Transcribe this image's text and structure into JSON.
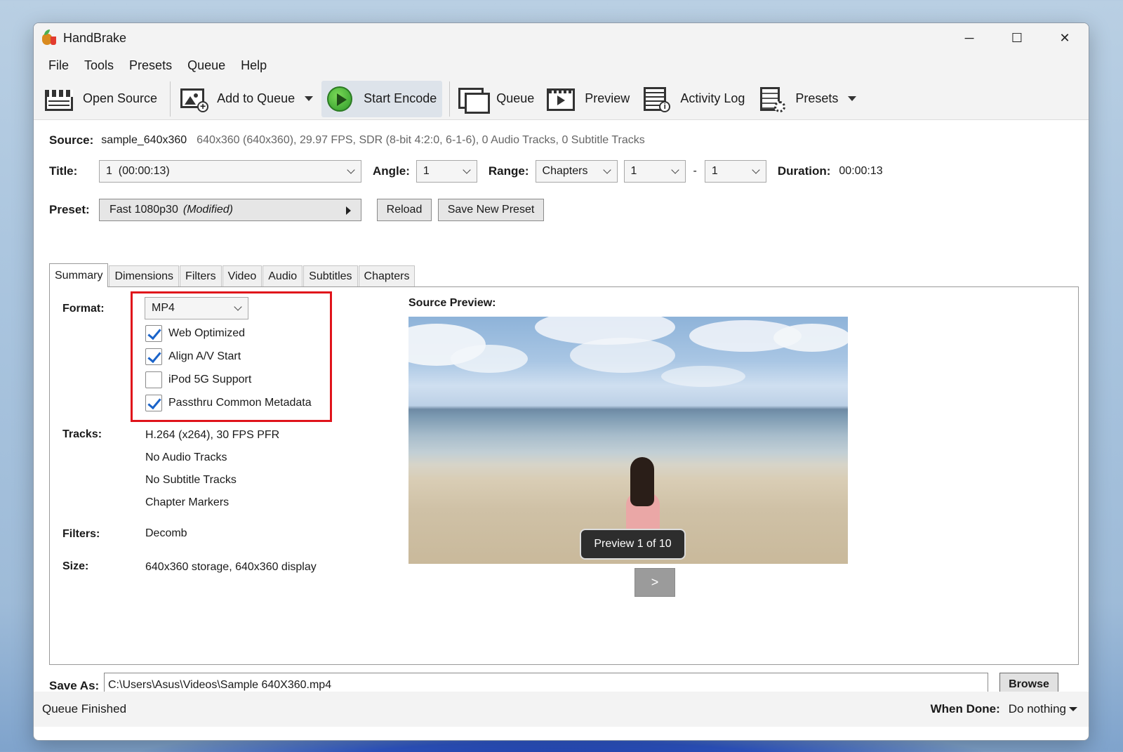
{
  "window": {
    "title": "HandBrake",
    "controls": [
      "─",
      "☐",
      "✕"
    ]
  },
  "menu": [
    "File",
    "Tools",
    "Presets",
    "Queue",
    "Help"
  ],
  "toolbar": {
    "open_source": "Open Source",
    "add_to_queue": "Add to Queue",
    "start_encode": "Start Encode",
    "queue": "Queue",
    "preview": "Preview",
    "activity_log": "Activity Log",
    "presets": "Presets"
  },
  "source": {
    "label": "Source:",
    "name": "sample_640x360",
    "info": "640x360 (640x360), 29.97 FPS, SDR (8-bit 4:2:0, 6-1-6), 0 Audio Tracks, 0 Subtitle Tracks"
  },
  "title_row": {
    "title_label": "Title:",
    "title_value": "1  (00:00:13)",
    "angle_label": "Angle:",
    "angle_value": "1",
    "range_label": "Range:",
    "range_value": "Chapters",
    "range_start": "1",
    "range_sep": "-",
    "range_end": "1",
    "duration_label": "Duration:",
    "duration_value": "00:00:13"
  },
  "preset": {
    "label": "Preset:",
    "name": "Fast 1080p30",
    "modified": "(Modified)",
    "reload": "Reload",
    "save_new": "Save New Preset"
  },
  "tabs": [
    "Summary",
    "Dimensions",
    "Filters",
    "Video",
    "Audio",
    "Subtitles",
    "Chapters"
  ],
  "summary": {
    "format_label": "Format:",
    "format_value": "MP4",
    "options": [
      {
        "label": "Web Optimized",
        "checked": true
      },
      {
        "label": "Align A/V Start",
        "checked": true
      },
      {
        "label": "iPod 5G Support",
        "checked": false
      },
      {
        "label": "Passthru Common Metadata",
        "checked": true
      }
    ],
    "tracks_label": "Tracks:",
    "tracks": [
      "H.264 (x264), 30 FPS PFR",
      "No Audio Tracks",
      "No Subtitle Tracks",
      "Chapter Markers"
    ],
    "filters_label": "Filters:",
    "filters_value": "Decomb",
    "size_label": "Size:",
    "size_value": "640x360 storage, 640x360 display",
    "source_preview_label": "Source Preview:",
    "preview_badge": "Preview 1 of 10",
    "next_label": ">"
  },
  "save_as": {
    "label": "Save As:",
    "path": "C:\\Users\\Asus\\Videos\\Sample 640X360.mp4",
    "browse": "Browse"
  },
  "status": {
    "left": "Queue Finished",
    "when_done_label": "When Done:",
    "when_done_value": "Do nothing"
  },
  "colors": {
    "highlight_box": "#e0141b",
    "check": "#1a63c9",
    "start_encode_bg": "#dde3ea"
  }
}
